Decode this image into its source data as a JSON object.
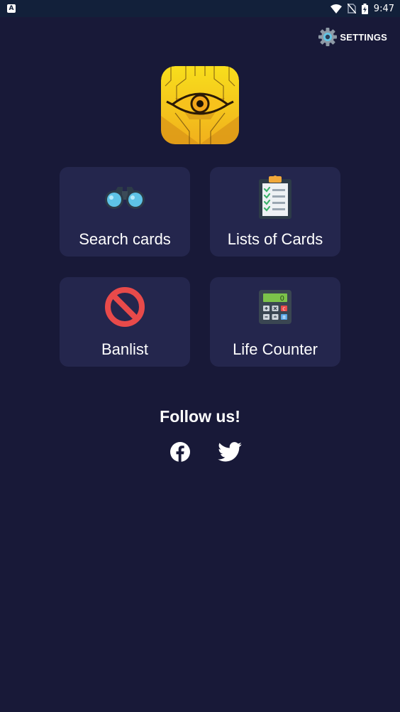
{
  "status_bar": {
    "notification_icon": "A",
    "time": "9:47",
    "icons": [
      "wifi-icon",
      "no-sim-icon",
      "battery-charging-icon"
    ]
  },
  "header": {
    "settings_label": "SETTINGS",
    "settings_icon": "gear-icon"
  },
  "logo": {
    "name": "millennium-eye-logo",
    "colors": [
      "#f5d21a",
      "#e8a718"
    ]
  },
  "tiles": [
    {
      "label": "Search cards",
      "icon": "binoculars-icon"
    },
    {
      "label": "Lists of Cards",
      "icon": "clipboard-checklist-icon"
    },
    {
      "label": "Banlist",
      "icon": "prohibited-icon"
    },
    {
      "label": "Life Counter",
      "icon": "calculator-icon"
    }
  ],
  "follow": {
    "title": "Follow us!",
    "links": [
      {
        "icon": "facebook-icon"
      },
      {
        "icon": "twitter-icon"
      }
    ]
  },
  "colors": {
    "background": "#181938",
    "tile": "#24264d",
    "status_bar": "#12203a"
  }
}
